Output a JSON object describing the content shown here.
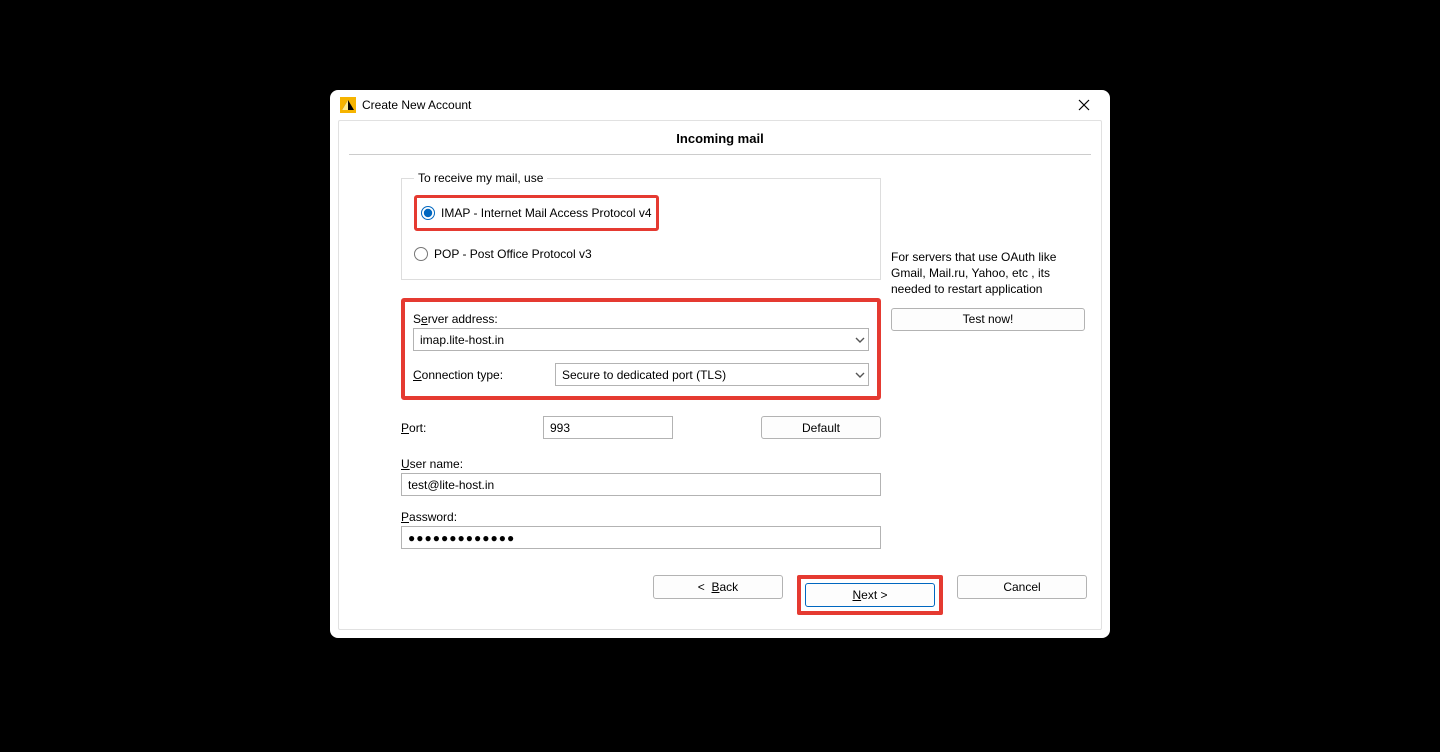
{
  "window": {
    "title": "Create New Account"
  },
  "heading": "Incoming mail",
  "group": {
    "legend": "To receive my mail, use",
    "imap_label": "IMAP - Internet Mail Access Protocol v4",
    "pop_label": "POP  -  Post Office Protocol v3"
  },
  "server": {
    "label_pre": "S",
    "label_u": "e",
    "label_post": "rver address:",
    "value": "imap.lite-host.in"
  },
  "conn": {
    "label_u": "C",
    "label_post": "onnection type:",
    "value": "Secure to dedicated port (TLS)"
  },
  "port": {
    "label_u": "P",
    "label_post": "ort:",
    "value": "993"
  },
  "default_btn": "Default",
  "user": {
    "label_u": "U",
    "label_post": "ser name:",
    "value": "test@lite-host.in"
  },
  "password": {
    "label_u": "P",
    "label_post": "assword:",
    "value": "●●●●●●●●●●●●●"
  },
  "side": {
    "note": "For servers that use OAuth like Gmail, Mail.ru, Yahoo, etc , its needed to restart application",
    "test_btn": "Test now!"
  },
  "footer": {
    "back": "<  Back",
    "next_pre": "N",
    "next_post": "ext  >",
    "cancel": "Cancel"
  }
}
